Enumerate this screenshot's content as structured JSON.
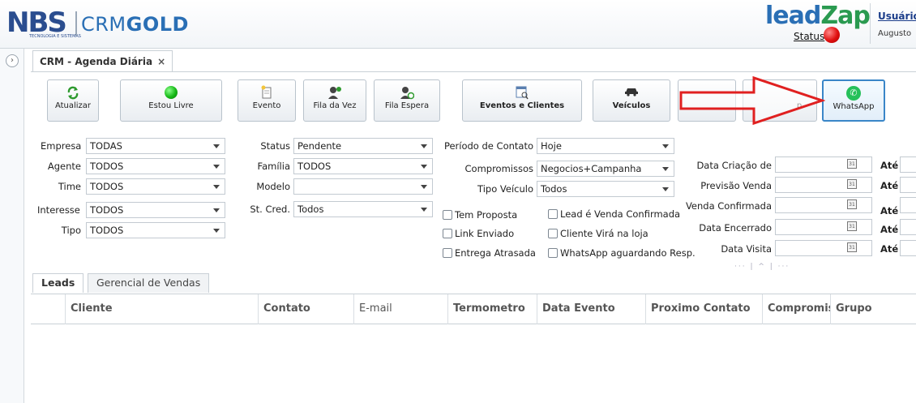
{
  "header": {
    "logo_nbs": "NBS",
    "logo_nbs_sub": "TECNOLOGIA E SISTEMAS",
    "logo_crm": "CRM",
    "logo_gold": "GOLD",
    "leadzap_text_a": "lead",
    "leadzap_text_b": "Zap",
    "status_label": "Status",
    "status_color": "#e01010",
    "user_label": "Usuário",
    "user_name": "Augusto"
  },
  "tab": {
    "title": "CRM - Agenda Diária",
    "close": "×"
  },
  "toolbar": {
    "atualizar": "Atualizar",
    "estou_livre": "Estou Livre",
    "evento": "Evento",
    "fila_da_vez": "Fila da Vez",
    "fila_espera": "Fila Espera",
    "eventos_clientes": "Eventos e Clientes",
    "veiculos": "Veículos",
    "hidden_btn_tail": "p",
    "whatsapp": "WhatsApp",
    "accent": "#3a86c8",
    "annotation_arrow_color": "#e02020"
  },
  "filters": {
    "col1": [
      {
        "label": "Empresa",
        "value": "TODAS"
      },
      {
        "label": "Agente",
        "value": "TODOS"
      },
      {
        "label": "Time",
        "value": "TODOS"
      },
      {
        "label": "Interesse",
        "value": "TODOS"
      },
      {
        "label": "Tipo",
        "value": "TODOS"
      }
    ],
    "col2": [
      {
        "label": "Status",
        "value": "Pendente"
      },
      {
        "label": "Família",
        "value": "TODOS"
      },
      {
        "label": "Modelo",
        "value": ""
      },
      {
        "label": "St. Cred.",
        "value": "Todos"
      }
    ],
    "col3": [
      {
        "label": "Período de Contato",
        "value": "Hoje"
      },
      {
        "label": "Compromissos",
        "value": "Negocios+Campanha"
      },
      {
        "label": "Tipo Veículo",
        "value": "Todos"
      }
    ],
    "checkboxes": [
      "Tem Proposta",
      "Lead é Venda Confirmada",
      "Link Enviado",
      "Cliente Virá na loja",
      "Entrega Atrasada",
      "WhatsApp aguardando Resp."
    ],
    "dates": [
      {
        "label": "Data Criação de",
        "to": "Até"
      },
      {
        "label": "Previsão Venda",
        "to": "Até"
      },
      {
        "label": "Venda Confirmada",
        "to": "Até"
      },
      {
        "label": "Data Encerrado",
        "to": "Até"
      },
      {
        "label": "Data Visita",
        "to": "Até"
      }
    ],
    "calendar_glyph": "31"
  },
  "lower_tabs": [
    "Leads",
    "Gerencial de Vendas"
  ],
  "grid": {
    "columns": [
      "Cliente",
      "Contato",
      "E-mail",
      "Termometro",
      "Data Evento",
      "Proximo Contato",
      "Compromisso",
      "Grupo"
    ]
  }
}
